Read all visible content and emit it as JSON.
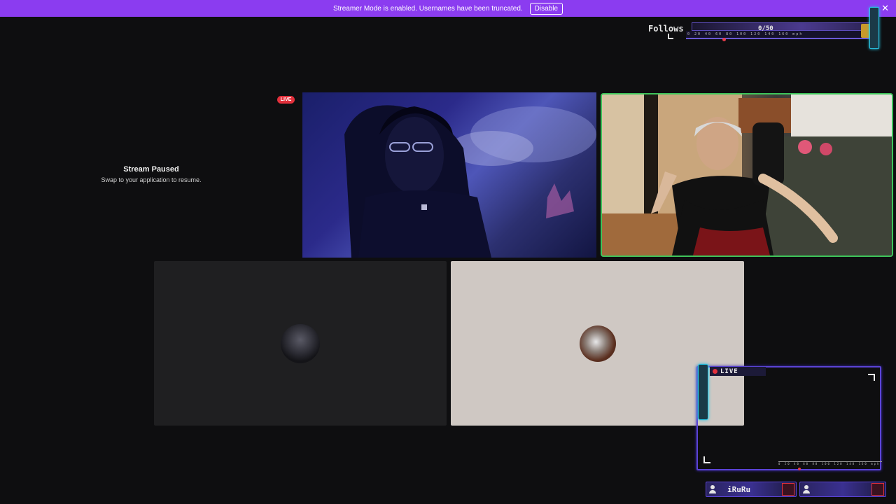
{
  "banner": {
    "message": "Streamer Mode is enabled. Usernames have been truncated.",
    "disable_label": "Disable",
    "close_glyph": "✕",
    "color": "#8b3cf0"
  },
  "follows_overlay": {
    "label": "Follows",
    "count": "0/50",
    "gauge_ticks": "0 20 40 60 80 100 120 140 160 mph"
  },
  "paused_tile": {
    "title": "Stream Paused",
    "subtitle": "Swap to your application to resume.",
    "live_badge": "LIVE"
  },
  "video_tiles": [
    {
      "kind": "camera",
      "speaking": false
    },
    {
      "kind": "camera",
      "speaking": true,
      "highlight_color": "#3ec45a"
    }
  ],
  "avatar_tiles": [
    {
      "kind": "avatar",
      "background": "#1f1f21"
    },
    {
      "kind": "avatar",
      "background": "#cfc8c3"
    }
  ],
  "live_overlay": {
    "live_text": "LIVE",
    "gauge_ticks": "0 20 40 60 80 100 120 140 160 mph"
  },
  "name_plates": [
    {
      "name": "iRuRu"
    },
    {
      "name": ""
    }
  ],
  "icons": [
    "close-icon",
    "user-icon",
    "live-dot-icon"
  ]
}
